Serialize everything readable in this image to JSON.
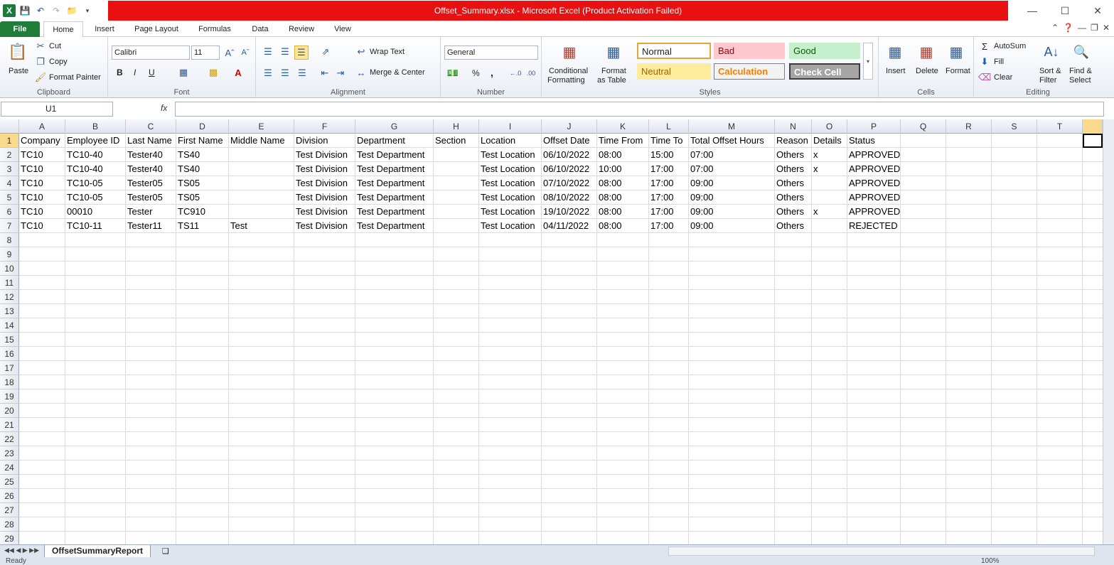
{
  "window": {
    "title": "Offset_Summary.xlsx  -  Microsoft Excel (Product Activation Failed)"
  },
  "tabs": [
    "File",
    "Home",
    "Insert",
    "Page Layout",
    "Formulas",
    "Data",
    "Review",
    "View"
  ],
  "ribbon": {
    "clipboard": {
      "paste": "Paste",
      "cut": "Cut",
      "copy": "Copy",
      "format_painter": "Format Painter",
      "label": "Clipboard"
    },
    "font": {
      "name": "Calibri",
      "size": "11",
      "bold": "B",
      "italic": "I",
      "underline": "U",
      "label": "Font"
    },
    "alignment": {
      "wrap": "Wrap Text",
      "merge": "Merge & Center",
      "label": "Alignment"
    },
    "number": {
      "format": "General",
      "percent": "%",
      "comma": ",",
      "label": "Number"
    },
    "styles": {
      "conditional": "Conditional",
      "formatting": "Formatting",
      "format": "Format",
      "as_table": "as Table",
      "normal": "Normal",
      "bad": "Bad",
      "good": "Good",
      "neutral": "Neutral",
      "calculation": "Calculation",
      "check_cell": "Check Cell",
      "label": "Styles"
    },
    "cells": {
      "insert": "Insert",
      "delete": "Delete",
      "format": "Format",
      "label": "Cells"
    },
    "editing": {
      "autosum": "AutoSum",
      "fill": "Fill",
      "clear": "Clear",
      "sort": "Sort &",
      "filter": "Filter",
      "find": "Find &",
      "select": "Select",
      "label": "Editing"
    }
  },
  "formula_bar": {
    "name_box": "U1",
    "fx": "fx",
    "value": ""
  },
  "columns": [
    "A",
    "B",
    "C",
    "D",
    "E",
    "F",
    "G",
    "H",
    "I",
    "J",
    "K",
    "L",
    "M",
    "N",
    "O",
    "P",
    "Q",
    "R",
    "S",
    "T"
  ],
  "rows": [
    [
      "Company",
      "Employee ID",
      "Last Name",
      "First Name",
      "Middle Name",
      "Division",
      "Department",
      "Section",
      "Location",
      "Offset Date",
      "Time From",
      "Time To",
      "Total Offset Hours",
      "Reason",
      "Details",
      "Status"
    ],
    [
      "TC10",
      "TC10-40",
      "Tester40",
      "TS40",
      "",
      "Test Division",
      "Test Department",
      "",
      "Test Location",
      "06/10/2022",
      "08:00",
      "15:00",
      "07:00",
      "Others",
      "x",
      "APPROVED"
    ],
    [
      "TC10",
      "TC10-40",
      "Tester40",
      "TS40",
      "",
      "Test Division",
      "Test Department",
      "",
      "Test Location",
      "06/10/2022",
      "10:00",
      "17:00",
      "07:00",
      "Others",
      "x",
      "APPROVED"
    ],
    [
      "TC10",
      "TC10-05",
      "Tester05",
      "TS05",
      "",
      "Test Division",
      "Test Department",
      "",
      "Test Location",
      "07/10/2022",
      "08:00",
      "17:00",
      "09:00",
      "Others",
      "",
      "APPROVED"
    ],
    [
      "TC10",
      "TC10-05",
      "Tester05",
      "TS05",
      "",
      "Test Division",
      "Test Department",
      "",
      "Test Location",
      "08/10/2022",
      "08:00",
      "17:00",
      "09:00",
      "Others",
      "",
      "APPROVED"
    ],
    [
      "TC10",
      "00010",
      "Tester",
      "TC910",
      "",
      "Test Division",
      "Test Department",
      "",
      "Test Location",
      "19/10/2022",
      "08:00",
      "17:00",
      "09:00",
      "Others",
      "x",
      "APPROVED"
    ],
    [
      "TC10",
      "TC10-11",
      "Tester11",
      "TS11",
      "Test",
      "Test Division",
      "Test Department",
      "",
      "Test Location",
      "04/11/2022",
      "08:00",
      "17:00",
      "09:00",
      "Others",
      "",
      "REJECTED"
    ]
  ],
  "row_count": 29,
  "sheet": {
    "name": "OffsetSummaryReport"
  },
  "status": {
    "ready": "Ready",
    "zoom": "100%"
  }
}
